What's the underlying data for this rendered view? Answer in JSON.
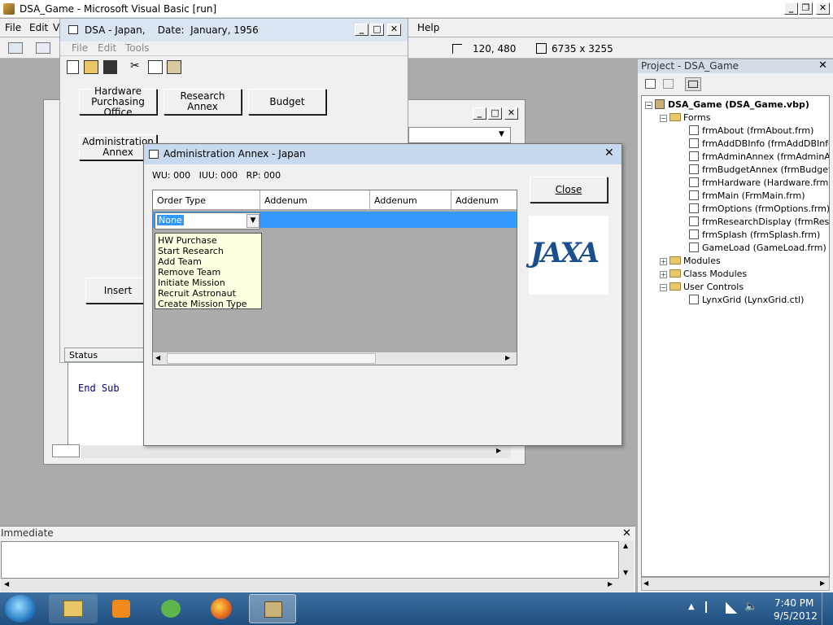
{
  "ide": {
    "title": "DSA_Game - Microsoft Visual Basic [run]",
    "menu": [
      "File",
      "Edit",
      "V",
      "Help"
    ],
    "position_readout": "120, 480",
    "size_readout": "6735 x 3255"
  },
  "project": {
    "title": "Project - DSA_Game",
    "root": "DSA_Game (DSA_Game.vbp)",
    "forms_label": "Forms",
    "forms": [
      "frmAbout (frmAbout.frm)",
      "frmAddDBInfo (frmAddDBInfo.fr",
      "frmAdminAnnex (frmAdminAnnex",
      "frmBudgetAnnex (frmBudgetAnn",
      "frmHardware (Hardware.frm)",
      "frmMain (FrmMain.frm)",
      "frmOptions (frmOptions.frm)",
      "frmResearchDisplay (frmResearc",
      "frmSplash (frmSplash.frm)",
      "GameLoad (GameLoad.frm)"
    ],
    "modules": "Modules",
    "class_modules": "Class Modules",
    "user_controls": "User Controls",
    "lynxgrid": "LynxGrid (LynxGrid.ctl)"
  },
  "immediate": {
    "title": "Immediate"
  },
  "code": {
    "end_sub": "End Sub"
  },
  "main_window": {
    "title": "DSA - Japan,    Date:  January, 1956",
    "menu": [
      "File",
      "Edit",
      "Tools"
    ],
    "buttons": {
      "hardware": "Hardware Purchasing Office",
      "research": "Research Annex",
      "budget": "Budget",
      "admin": "Administration Annex",
      "insert": "Insert"
    },
    "status": "Status"
  },
  "annex": {
    "title": "Administration Annex - Japan",
    "stats": "WU: 000   IUU: 000   RP: 000",
    "close": "Close",
    "grid": {
      "headers": [
        "Order Type",
        "Addenum",
        "Addenum",
        "Addenum"
      ],
      "combo_value": "None",
      "options": [
        "HW Purchase",
        "Start Research",
        "Add Team",
        "Remove Team",
        "Initiate Mission",
        "Recruit Astronaut",
        "Create Mission Type"
      ]
    },
    "logo": "JAXA"
  },
  "taskbar": {
    "time": "7:40 PM",
    "date": "9/5/2012"
  },
  "colors": {
    "titlebar_active": "#c7d9ef",
    "selection": "#3399ff",
    "taskbar": "#1f4f7f"
  }
}
